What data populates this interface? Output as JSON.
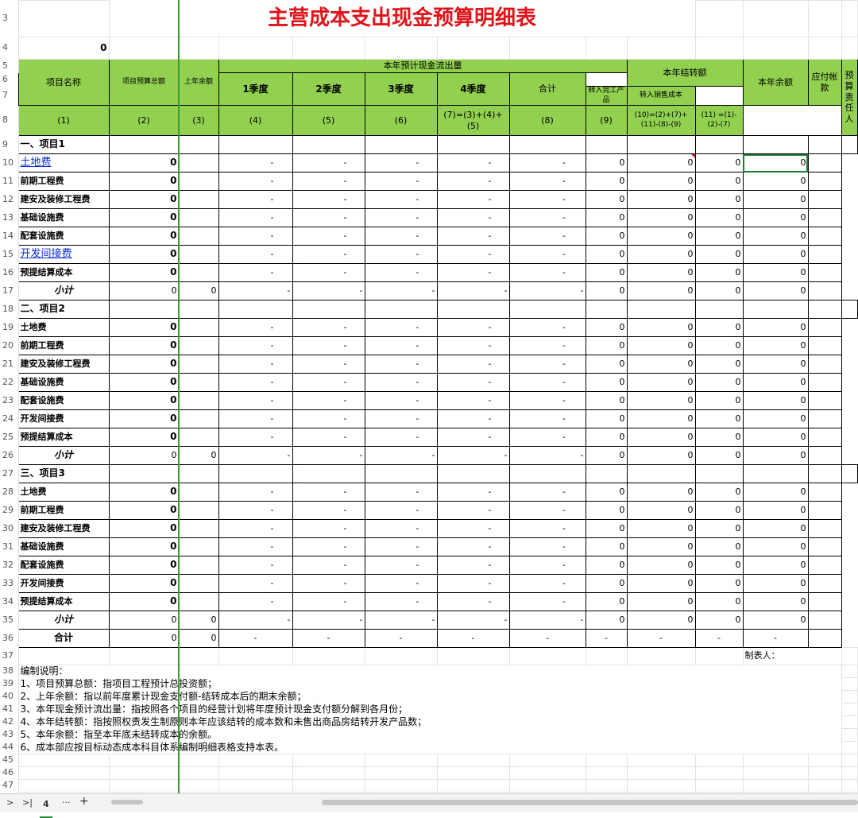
{
  "title": "主营成本支出现金预算明细表",
  "row4_value": "0",
  "header": {
    "project_name": "项目名称",
    "budget_total": "项目预算总额",
    "last_year_balance": "上年余额",
    "cashflow_group": "本年预计现金流出量",
    "q1": "1季度",
    "q2": "2季度",
    "q3": "3季度",
    "q4": "4季度",
    "total": "合计",
    "transfer_group": "本年结转额",
    "to_finished": "转入完工产品",
    "to_sales_cost": "转入销售成本",
    "year_end_balance": "本年余额",
    "payables": "应付帐款",
    "owner": "预算责任人",
    "c1": "(1)",
    "c2": "(2)",
    "c3": "(3)",
    "c4": "(4)",
    "c5": "(5)",
    "c6": "(6)",
    "c7": "(7)=(3)+(4)+(5)",
    "c8": "(8)",
    "c9": "(9)",
    "c10": "(10)=(2)+(7)+(11)-(8)-(9)",
    "c11": "(11) =(1)-(2)-(7)"
  },
  "sections": [
    {
      "row": 9,
      "label": "一、项目1"
    },
    {
      "row": 18,
      "label": "二、项目2"
    },
    {
      "row": 27,
      "label": "三、项目3"
    }
  ],
  "items": [
    {
      "row": 10,
      "name": "土地费",
      "link": true
    },
    {
      "row": 11,
      "name": "前期工程费"
    },
    {
      "row": 12,
      "name": "建安及装修工程费"
    },
    {
      "row": 13,
      "name": "基础设施费"
    },
    {
      "row": 14,
      "name": "配套设施费"
    },
    {
      "row": 15,
      "name": "开发间接费",
      "link": true
    },
    {
      "row": 16,
      "name": "预提结算成本"
    },
    {
      "row": 19,
      "name": "土地费"
    },
    {
      "row": 20,
      "name": "前期工程费"
    },
    {
      "row": 21,
      "name": "建安及装修工程费"
    },
    {
      "row": 22,
      "name": "基础设施费"
    },
    {
      "row": 23,
      "name": "配套设施费"
    },
    {
      "row": 24,
      "name": "开发间接费"
    },
    {
      "row": 25,
      "name": "预提结算成本"
    },
    {
      "row": 28,
      "name": "土地费"
    },
    {
      "row": 29,
      "name": "前期工程费"
    },
    {
      "row": 30,
      "name": "建安及装修工程费"
    },
    {
      "row": 31,
      "name": "基础设施费"
    },
    {
      "row": 32,
      "name": "配套设施费"
    },
    {
      "row": 33,
      "name": "开发间接费"
    },
    {
      "row": 34,
      "name": "预提结算成本"
    }
  ],
  "subtotal_label": "小计",
  "subtotal_rows": [
    17,
    26,
    35
  ],
  "grand_total_label": "合计",
  "grand_total_row": 36,
  "zero": "0",
  "dash": "-",
  "preparer": "制表人：",
  "notes": [
    {
      "row": 38,
      "text": "编制说明："
    },
    {
      "row": 39,
      "text": "1、项目预算总额：指项目工程预计总投资额；"
    },
    {
      "row": 40,
      "text": "2、上年余额：指以前年度累计现金支付额-结转成本后的期末余额；"
    },
    {
      "row": 41,
      "text": "3、本年现金预计流出量：指按照各个项目的经营计划将年度预计现金支付额分解到各月份；"
    },
    {
      "row": 42,
      "text": "4、本年结转额：指按照权责发生制原则本年应该结转的成本数和未售出商品房结转开发产品数；"
    },
    {
      "row": 43,
      "text": "5、本年余额：指至本年底未结转成本的余额。"
    },
    {
      "row": 44,
      "text": "6、成本部应按目标动态成本科目体系编制明细表格支持本表。"
    }
  ],
  "sheet_tab": "4",
  "bottom_bar": {
    "nav_next": ">",
    "nav_last": ">|",
    "more": "···",
    "add": "+"
  }
}
